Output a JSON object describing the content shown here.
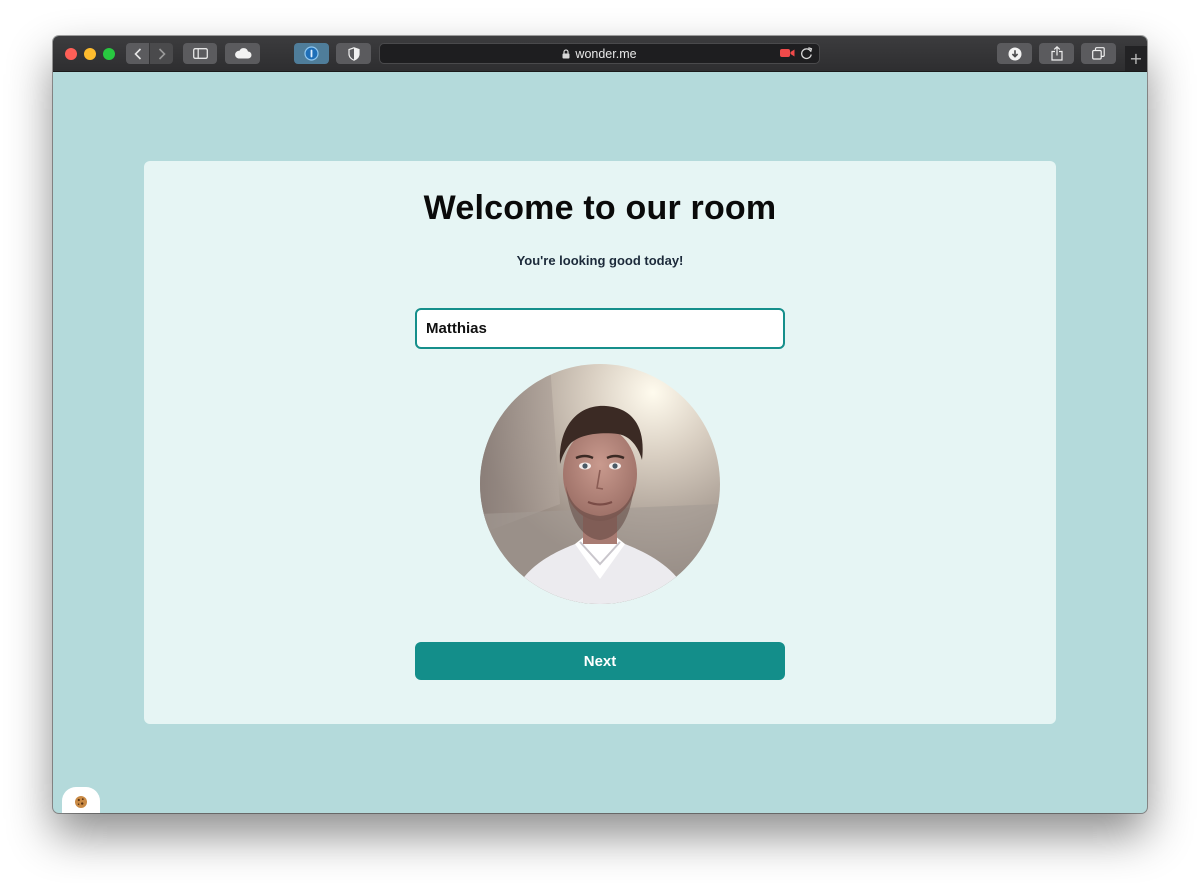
{
  "browser": {
    "url": "wonder.me",
    "toolbar_icons": [
      "back-icon",
      "forward-icon",
      "sidebar-icon",
      "cloud-icon",
      "password-manager-icon",
      "shield-icon",
      "lock-icon",
      "camera-icon",
      "reload-icon",
      "download-icon",
      "share-icon",
      "tabs-icon",
      "plus-icon"
    ],
    "new_tab_label": "+"
  },
  "page": {
    "title": "Welcome to our room",
    "subtitle": "You're looking good today!",
    "name_input": {
      "value": "Matthias"
    },
    "next_label": "Next",
    "cookie_icon": "cookie-icon"
  },
  "colors": {
    "page_background": "#b4dadb",
    "card_background": "#e6f5f4",
    "accent": "#138e8a",
    "recording_red": "#f04a4a"
  }
}
